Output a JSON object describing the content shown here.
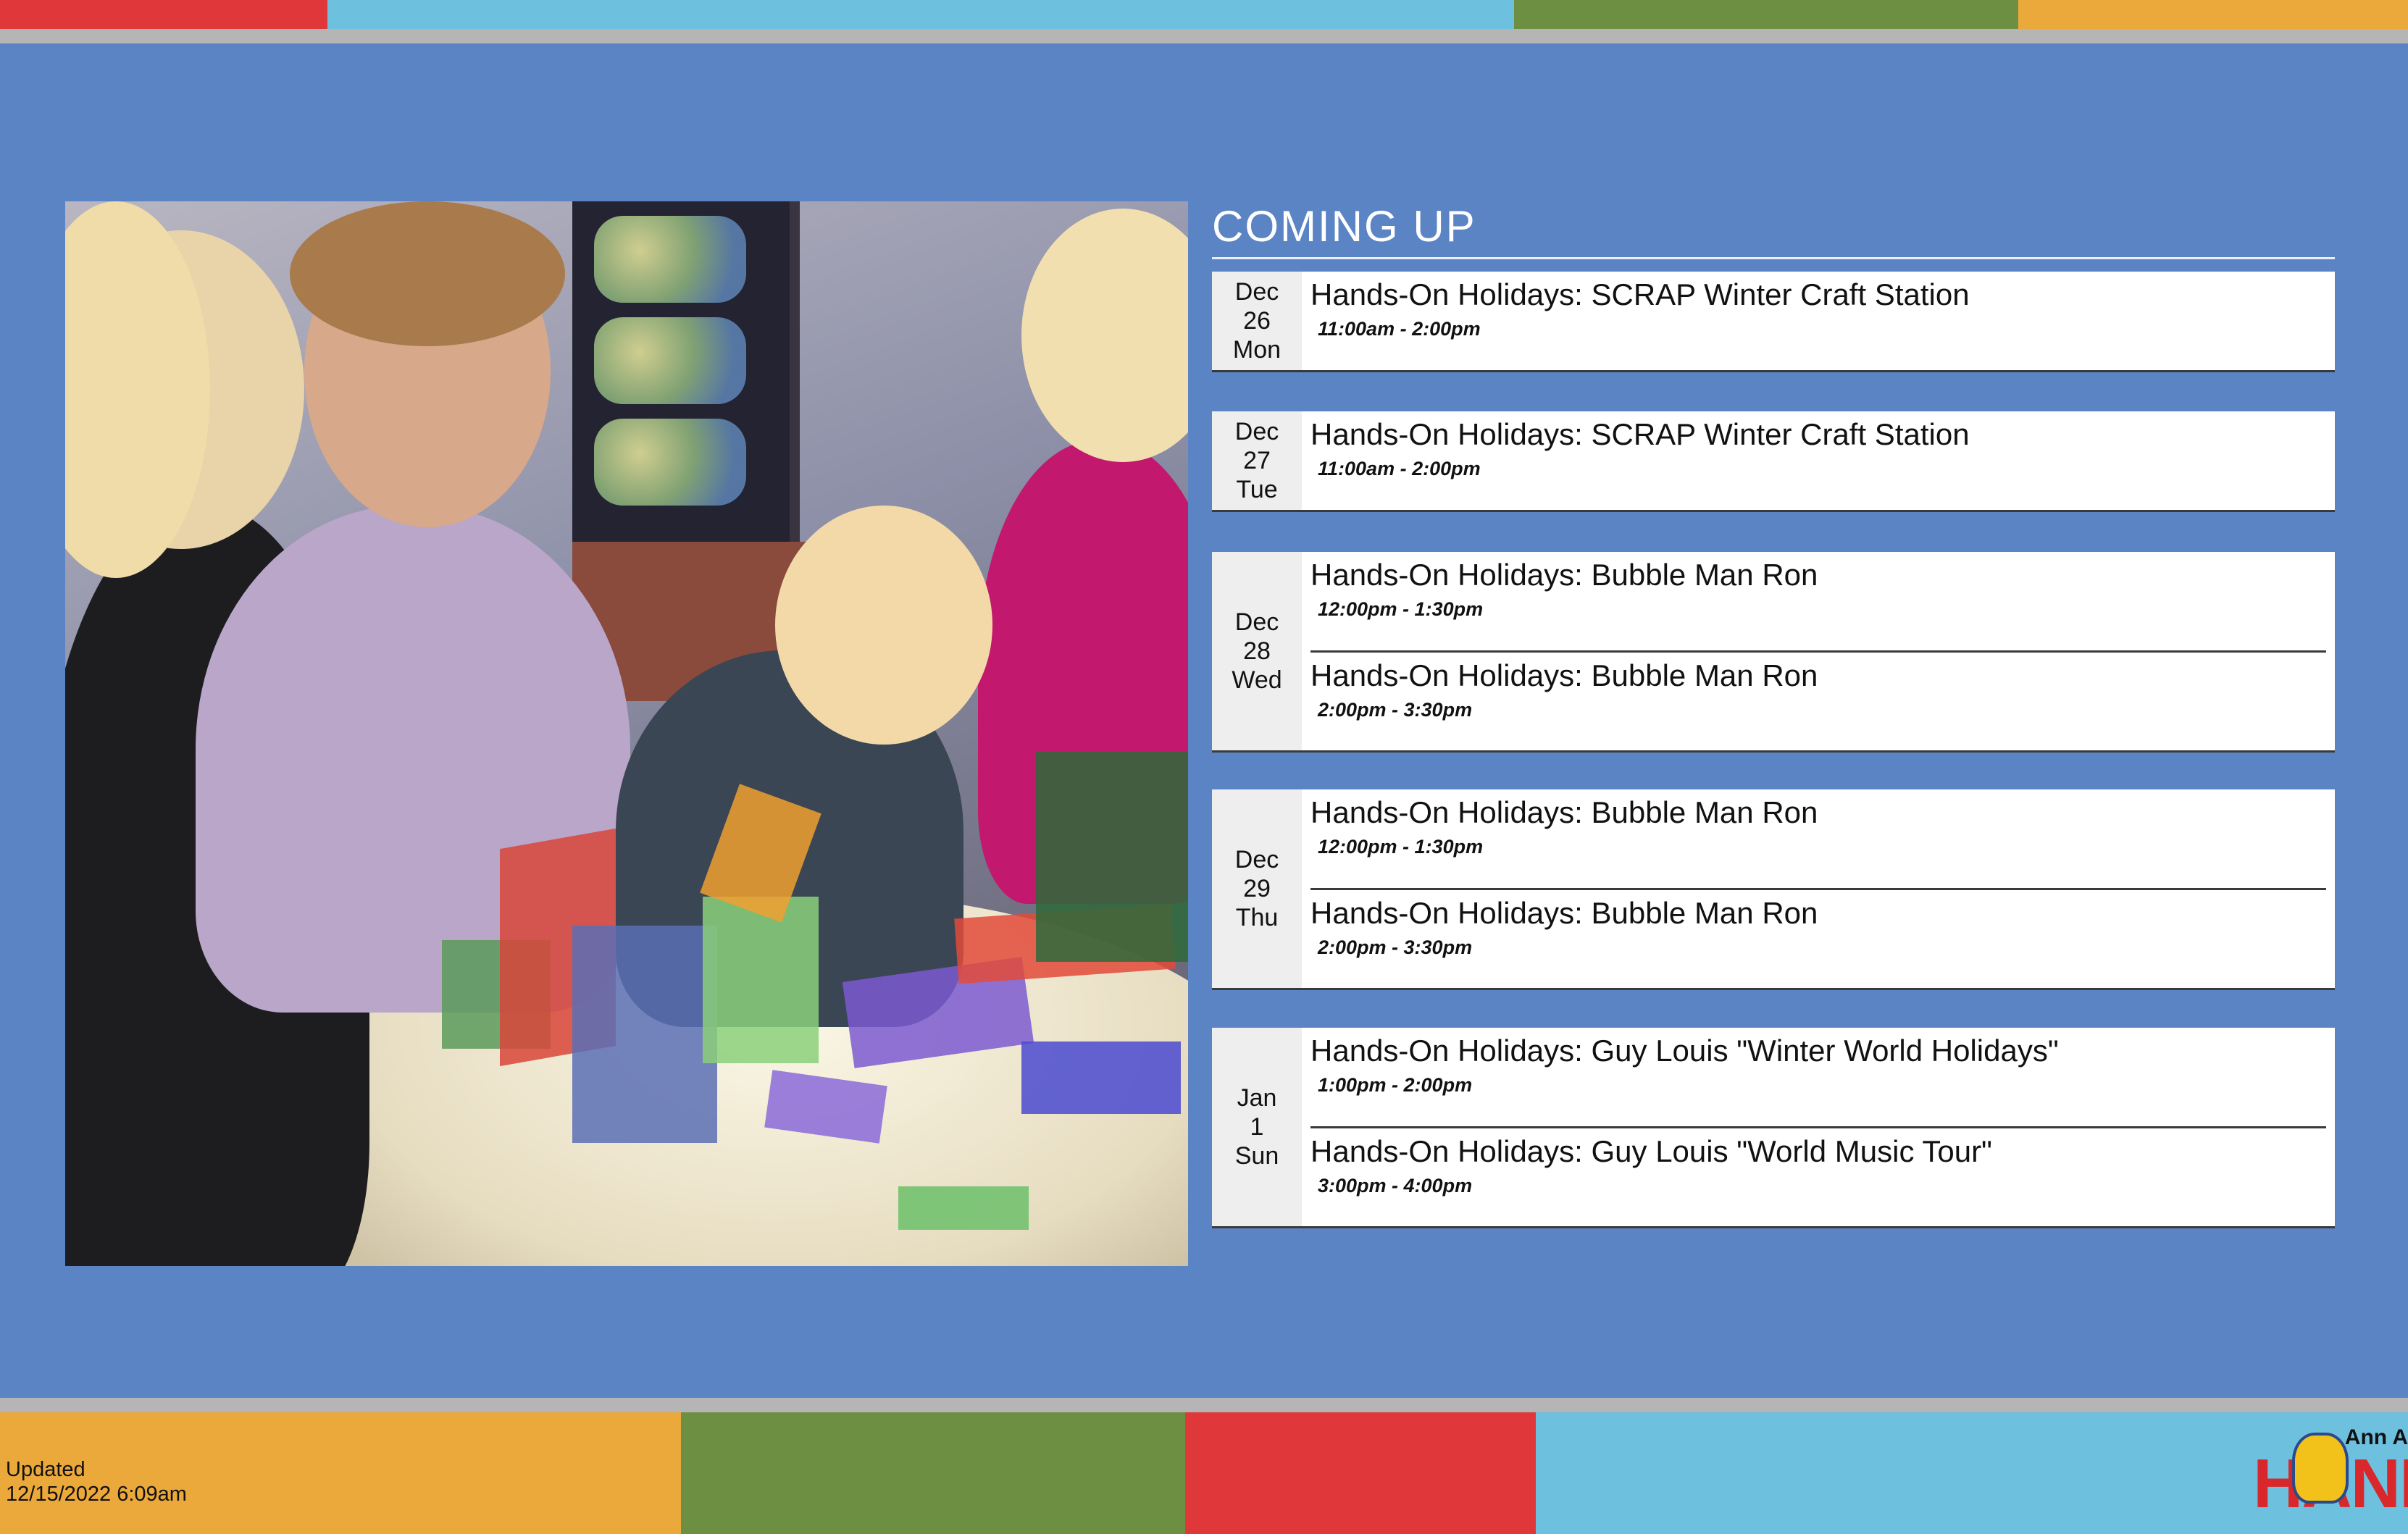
{
  "header": {
    "stripe_colors": [
      "#e0383a",
      "#6ec0df",
      "#6d8f41",
      "#eca93b"
    ]
  },
  "photo": {
    "icon": "museum-photo"
  },
  "coming_up": {
    "title": "COMING UP",
    "days": [
      {
        "month": "Dec",
        "date": "26",
        "weekday": "Mon",
        "events": [
          {
            "title": "Hands-On Holidays: SCRAP Winter Craft Station",
            "time": "11:00am - 2:00pm"
          }
        ]
      },
      {
        "month": "Dec",
        "date": "27",
        "weekday": "Tue",
        "events": [
          {
            "title": "Hands-On Holidays: SCRAP Winter Craft Station",
            "time": "11:00am - 2:00pm"
          }
        ]
      },
      {
        "month": "Dec",
        "date": "28",
        "weekday": "Wed",
        "events": [
          {
            "title": "Hands-On Holidays: Bubble Man Ron",
            "time": "12:00pm - 1:30pm"
          },
          {
            "title": "Hands-On Holidays: Bubble Man Ron",
            "time": "2:00pm - 3:30pm"
          }
        ]
      },
      {
        "month": "Dec",
        "date": "29",
        "weekday": "Thu",
        "events": [
          {
            "title": "Hands-On Holidays: Bubble Man Ron",
            "time": "12:00pm - 1:30pm"
          },
          {
            "title": "Hands-On Holidays: Bubble Man Ron",
            "time": "2:00pm - 3:30pm"
          }
        ]
      },
      {
        "month": "Jan",
        "date": "1",
        "weekday": "Sun",
        "events": [
          {
            "title": "Hands-On Holidays: Guy Louis \"Winter World Holidays\"",
            "time": "1:00pm - 2:00pm"
          },
          {
            "title": "Hands-On Holidays: Guy Louis \"World Music Tour\"",
            "time": "3:00pm - 4:00pm"
          }
        ]
      }
    ]
  },
  "footer": {
    "updated_label": "Updated",
    "updated_value": "12/15/2022 6:09am",
    "stripe_colors": [
      "#eca93b",
      "#6d8f41",
      "#e0383a",
      "#6ec0df"
    ],
    "logo_top": "Ann A",
    "logo_main": "HANDS"
  }
}
